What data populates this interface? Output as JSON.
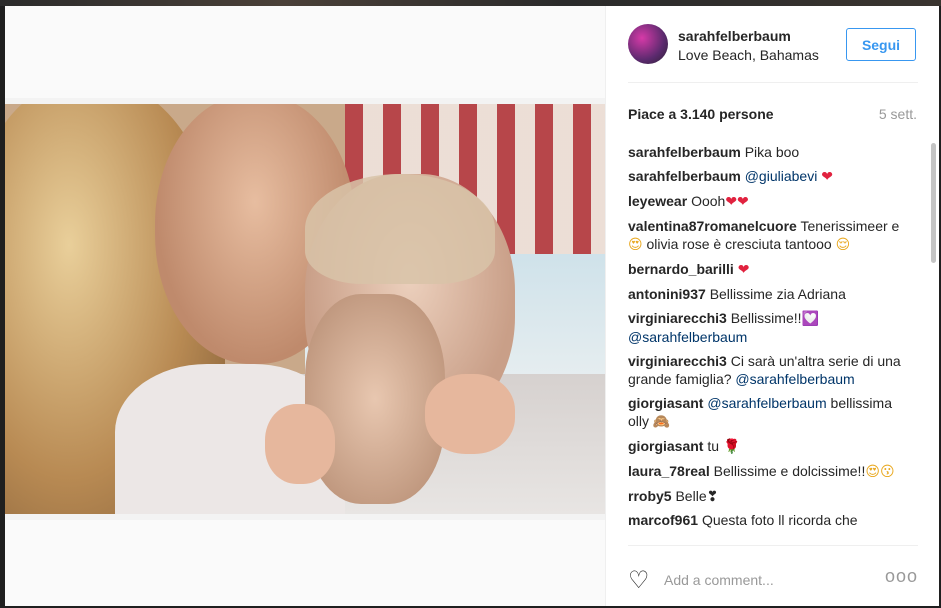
{
  "post": {
    "username": "sarahfelberbaum",
    "location": "Love Beach, Bahamas",
    "follow_label": "Segui",
    "likes_text": "Piace a 3.140 persone",
    "time_ago": "5 sett."
  },
  "comments": [
    {
      "user": "sarahfelberbaum",
      "parts": [
        {
          "t": "Pika boo"
        }
      ]
    },
    {
      "user": "sarahfelberbaum",
      "parts": [
        {
          "t": "@giuliabevi",
          "k": "mention"
        },
        {
          "t": " "
        },
        {
          "t": "❤",
          "k": "red"
        }
      ]
    },
    {
      "user": "leyewear",
      "parts": [
        {
          "t": "Oooh"
        },
        {
          "t": "❤❤",
          "k": "red"
        }
      ]
    },
    {
      "user": "valentina87romanelcuore",
      "parts": [
        {
          "t": "Tenerissimeer e"
        },
        {
          "t": "😍",
          "k": "yellow"
        },
        {
          "t": " olivia rose è cresciuta tantooo "
        },
        {
          "t": "😌",
          "k": "yellow"
        }
      ]
    },
    {
      "user": "bernardo_barilli",
      "parts": [
        {
          "t": "❤",
          "k": "red"
        }
      ]
    },
    {
      "user": "antonini937",
      "parts": [
        {
          "t": "Bellissime zia Adriana"
        }
      ]
    },
    {
      "user": "virginiarecchi3",
      "parts": [
        {
          "t": "Bellissime!!"
        },
        {
          "t": "💟",
          "k": "pink"
        },
        {
          "t": "@sarahfelberbaum",
          "k": "mention"
        }
      ]
    },
    {
      "user": "virginiarecchi3",
      "parts": [
        {
          "t": "Ci sarà un'altra serie di una grande famiglia? "
        },
        {
          "t": "@sarahfelberbaum",
          "k": "mention"
        }
      ]
    },
    {
      "user": "giorgiasant",
      "parts": [
        {
          "t": "@sarahfelberbaum",
          "k": "mention"
        },
        {
          "t": " bellissima olly "
        },
        {
          "t": "🙈",
          "k": "yellow"
        }
      ]
    },
    {
      "user": "giorgiasant",
      "parts": [
        {
          "t": "tu "
        },
        {
          "t": "🌹",
          "k": "red"
        }
      ]
    },
    {
      "user": "laura_78real",
      "parts": [
        {
          "t": "Bellissime e dolcissime!!"
        },
        {
          "t": "😍😗",
          "k": "yellow"
        }
      ]
    },
    {
      "user": "rroby5",
      "parts": [
        {
          "t": "Belle"
        },
        {
          "t": "❣"
        }
      ]
    },
    {
      "user": "marcof961",
      "parts": [
        {
          "t": "Questa foto ll ricorda che"
        }
      ]
    }
  ],
  "footer": {
    "add_comment_placeholder": "Add a comment...",
    "more_label": "ooo"
  },
  "icons": {
    "like": "heart-outline-icon",
    "options": "more-options-icon"
  },
  "colors": {
    "follow_blue": "#3897f0",
    "text": "#262626",
    "muted": "#999999",
    "mention": "#003569"
  }
}
